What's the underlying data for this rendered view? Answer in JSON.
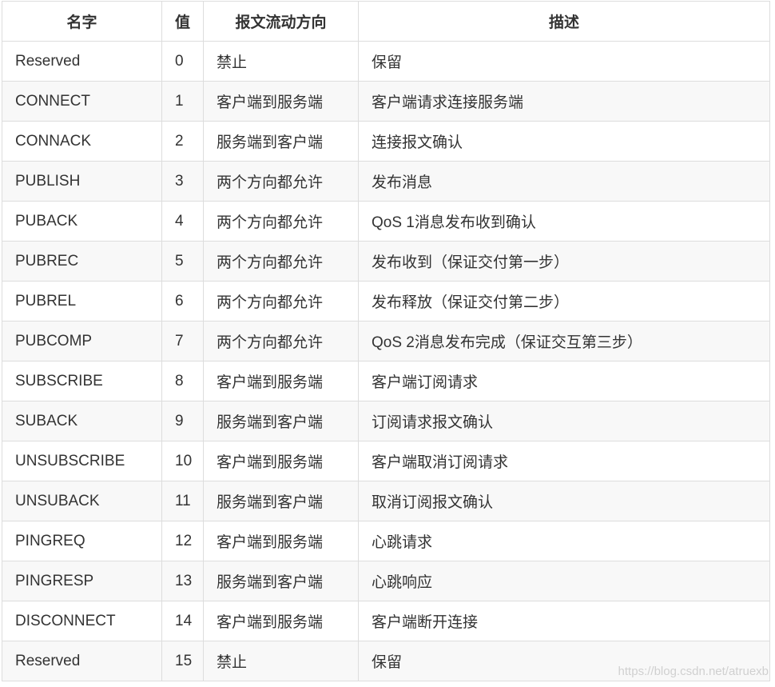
{
  "table": {
    "headers": [
      "名字",
      "值",
      "报文流动方向",
      "描述"
    ],
    "rows": [
      [
        "Reserved",
        "0",
        "禁止",
        "保留"
      ],
      [
        "CONNECT",
        "1",
        "客户端到服务端",
        "客户端请求连接服务端"
      ],
      [
        "CONNACK",
        "2",
        "服务端到客户端",
        "连接报文确认"
      ],
      [
        "PUBLISH",
        "3",
        "两个方向都允许",
        "发布消息"
      ],
      [
        "PUBACK",
        "4",
        "两个方向都允许",
        "QoS 1消息发布收到确认"
      ],
      [
        "PUBREC",
        "5",
        "两个方向都允许",
        "发布收到（保证交付第一步）"
      ],
      [
        "PUBREL",
        "6",
        "两个方向都允许",
        "发布释放（保证交付第二步）"
      ],
      [
        "PUBCOMP",
        "7",
        "两个方向都允许",
        "QoS 2消息发布完成（保证交互第三步）"
      ],
      [
        "SUBSCRIBE",
        "8",
        "客户端到服务端",
        "客户端订阅请求"
      ],
      [
        "SUBACK",
        "9",
        "服务端到客户端",
        "订阅请求报文确认"
      ],
      [
        "UNSUBSCRIBE",
        "10",
        "客户端到服务端",
        "客户端取消订阅请求"
      ],
      [
        "UNSUBACK",
        "11",
        "服务端到客户端",
        "取消订阅报文确认"
      ],
      [
        "PINGREQ",
        "12",
        "客户端到服务端",
        "心跳请求"
      ],
      [
        "PINGRESP",
        "13",
        "服务端到客户端",
        "心跳响应"
      ],
      [
        "DISCONNECT",
        "14",
        "客户端到服务端",
        "客户端断开连接"
      ],
      [
        "Reserved",
        "15",
        "禁止",
        "保留"
      ]
    ]
  },
  "watermark": "https://blog.csdn.net/atruexb"
}
